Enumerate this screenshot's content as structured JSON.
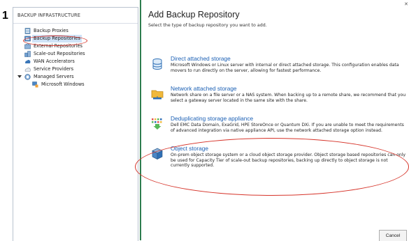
{
  "step_number": "1",
  "left_panel": {
    "header": "BACKUP INFRASTRUCTURE",
    "items": [
      {
        "label": "Backup Proxies",
        "icon": "backup-proxies-icon"
      },
      {
        "label": "Backup Repositories",
        "icon": "backup-repositories-icon",
        "selected": true
      },
      {
        "label": "External Repositories",
        "icon": "external-repositories-icon"
      },
      {
        "label": "Scale-out Repositories",
        "icon": "scale-out-repositories-icon"
      },
      {
        "label": "WAN Accelerators",
        "icon": "wan-accelerators-icon"
      },
      {
        "label": "Service Providers",
        "icon": "service-providers-icon"
      },
      {
        "label": "Managed Servers",
        "icon": "managed-servers-icon",
        "expanded": true
      },
      {
        "label": "Microsoft Windows",
        "icon": "microsoft-windows-icon"
      }
    ]
  },
  "dialog": {
    "title": "Add Backup Repository",
    "subtitle": "Select the type of backup repository you want to add.",
    "options": [
      {
        "title": "Direct attached storage",
        "description": "Microsoft Windows or Linux server with internal or direct attached storage. This configuration enables data movers to run directly on the server, allowing for fastest performance.",
        "icon": "direct-attached-storage-icon"
      },
      {
        "title": "Network attached storage",
        "description": "Network share on a file server or a NAS system. When backing up to a remote share, we recommend that you select a gateway server located in the same site with the share.",
        "icon": "network-attached-storage-icon"
      },
      {
        "title": "Deduplicating storage appliance",
        "description": "Dell EMC Data Domain, ExaGrid, HPE StoreOnce or Quantum DXi. If you are unable to meet the requirements of advanced integration via native appliance API, use the network attached storage option instead.",
        "icon": "deduplicating-storage-appliance-icon"
      },
      {
        "title": "Object storage",
        "description": "On-prem object storage system or a cloud object storage provider. Object storage based repositories can only be used for Capacity Tier of scale-out backup repositories, backing up directly to object storage is not currently supported.",
        "icon": "object-storage-icon"
      }
    ],
    "cancel_label": "Cancel"
  },
  "colors": {
    "accent_green": "#2e7d4f",
    "link_blue": "#1a5fb4",
    "annotation_red": "#d6342a",
    "selection_blue": "#cfe3f7"
  }
}
